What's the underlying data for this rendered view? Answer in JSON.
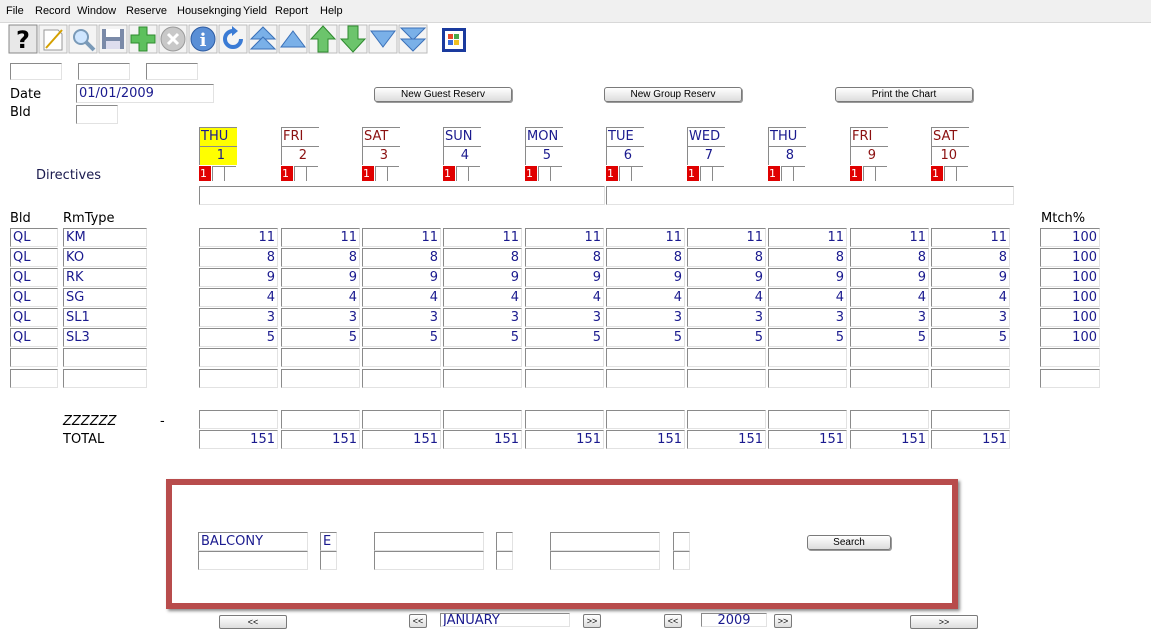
{
  "menu": [
    "File",
    "Record",
    "Window",
    "Reserve",
    "Houseknging",
    "Yield",
    "Report",
    "Help"
  ],
  "toolbar_icons": [
    "help-icon",
    "new-icon",
    "search-icon",
    "save-icon",
    "add-icon",
    "delete-icon",
    "info-icon",
    "refresh-icon",
    "first-record-icon",
    "previous-record-icon",
    "up-green-icon",
    "down-green-icon",
    "next-record-icon",
    "last-record-icon",
    "windows-icon"
  ],
  "header": {
    "date_label": "Date",
    "date_value": "01/01/2009",
    "bld_label": "Bld",
    "bld_value": "",
    "new_guest_btn": "New Guest Reserv",
    "new_group_btn": "New Group Reserv",
    "print_btn": "Print the Chart"
  },
  "directives_label": "Directives",
  "days": [
    {
      "dow": "THU",
      "num": "1",
      "weekend": false,
      "highlight": true,
      "badge": "1"
    },
    {
      "dow": "FRI",
      "num": "2",
      "weekend": true,
      "highlight": false,
      "badge": "1"
    },
    {
      "dow": "SAT",
      "num": "3",
      "weekend": true,
      "highlight": false,
      "badge": "1"
    },
    {
      "dow": "SUN",
      "num": "4",
      "weekend": false,
      "highlight": false,
      "badge": "1"
    },
    {
      "dow": "MON",
      "num": "5",
      "weekend": false,
      "highlight": false,
      "badge": "1"
    },
    {
      "dow": "TUE",
      "num": "6",
      "weekend": false,
      "highlight": false,
      "badge": "1"
    },
    {
      "dow": "WED",
      "num": "7",
      "weekend": false,
      "highlight": false,
      "badge": "1"
    },
    {
      "dow": "THU",
      "num": "8",
      "weekend": false,
      "highlight": false,
      "badge": "1"
    },
    {
      "dow": "FRI",
      "num": "9",
      "weekend": true,
      "highlight": false,
      "badge": "1"
    },
    {
      "dow": "SAT",
      "num": "10",
      "weekend": true,
      "highlight": false,
      "badge": "1"
    }
  ],
  "table": {
    "col_bld": "Bld",
    "col_rmtype": "RmType",
    "col_match": "Mtch%",
    "rows": [
      {
        "bld": "QL",
        "type": "KM",
        "values": [
          "11",
          "11",
          "11",
          "11",
          "11",
          "11",
          "11",
          "11",
          "11",
          "11"
        ],
        "match": "100"
      },
      {
        "bld": "QL",
        "type": "KO",
        "values": [
          "8",
          "8",
          "8",
          "8",
          "8",
          "8",
          "8",
          "8",
          "8",
          "8"
        ],
        "match": "100"
      },
      {
        "bld": "QL",
        "type": "RK",
        "values": [
          "9",
          "9",
          "9",
          "9",
          "9",
          "9",
          "9",
          "9",
          "9",
          "9"
        ],
        "match": "100"
      },
      {
        "bld": "QL",
        "type": "SG",
        "values": [
          "4",
          "4",
          "4",
          "4",
          "4",
          "4",
          "4",
          "4",
          "4",
          "4"
        ],
        "match": "100"
      },
      {
        "bld": "QL",
        "type": "SL1",
        "values": [
          "3",
          "3",
          "3",
          "3",
          "3",
          "3",
          "3",
          "3",
          "3",
          "3"
        ],
        "match": "100"
      },
      {
        "bld": "QL",
        "type": "SL3",
        "values": [
          "5",
          "5",
          "5",
          "5",
          "5",
          "5",
          "5",
          "5",
          "5",
          "5"
        ],
        "match": "100"
      },
      {
        "bld": "",
        "type": "",
        "values": [
          "",
          "",
          "",
          "",
          "",
          "",
          "",
          "",
          "",
          ""
        ],
        "match": ""
      },
      {
        "bld": "",
        "type": "",
        "values": [
          "",
          "",
          "",
          "",
          "",
          "",
          "",
          "",
          "",
          ""
        ],
        "match": ""
      }
    ],
    "zzz_label": "ZZZZZZ",
    "zzz_dash": "-",
    "zzz_values": [
      "",
      "",
      "",
      "",
      "",
      "",
      "",
      "",
      "",
      ""
    ],
    "total_label": "TOTAL",
    "total_values": [
      "151",
      "151",
      "151",
      "151",
      "151",
      "151",
      "151",
      "151",
      "151",
      "151"
    ]
  },
  "search": {
    "field1": "BALCONY",
    "field1_code": "E",
    "search_btn": "Search"
  },
  "nav": {
    "prev_big": "<<",
    "prev_month": "<<",
    "month": "JANUARY",
    "next_month": ">>",
    "prev_year": "<<",
    "year": "2009",
    "next_year": ">>",
    "next_big": ">>"
  },
  "colors": {
    "frame": "#b84c4c",
    "highlight": "#ffff00",
    "badge": "#e00000",
    "text_blue": "#1a1a8e",
    "text_red": "#8b1010"
  }
}
